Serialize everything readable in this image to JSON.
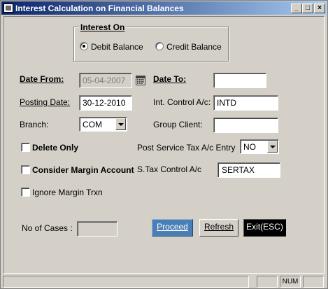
{
  "window": {
    "title": "Interest Calculation on Financial Balances",
    "minimize_glyph": "_",
    "maximize_glyph": "□",
    "close_glyph": "×"
  },
  "interest_on": {
    "label": "Interest On",
    "options": [
      "Debit Balance",
      "Credit Balance"
    ],
    "selected": "Debit Balance"
  },
  "form": {
    "date_from_label": "Date From:",
    "date_from_value": "05-04-2007",
    "date_to_label": "Date To:",
    "date_to_value": "",
    "posting_date_label": "Posting Date:",
    "posting_date_value": "30-12-2010",
    "int_control_label": "Int. Control A/c:",
    "int_control_value": "INTD",
    "branch_label": "Branch:",
    "branch_value": "COM",
    "group_client_label": "Group Client:",
    "group_client_value": "",
    "delete_only_label": "Delete Only",
    "post_service_tax_label": "Post Service Tax A/c Entry",
    "post_service_tax_value": "NO",
    "consider_margin_label": "Consider Margin Account",
    "stax_control_label": "S.Tax Control A/c",
    "stax_control_value": "SERTAX",
    "ignore_margin_label": "Ignore Margin Trxn",
    "no_of_cases_label": "No of Cases :",
    "no_of_cases_value": ""
  },
  "buttons": {
    "proceed": "Proceed",
    "refresh": "Refresh",
    "exit": "Exit(ESC)"
  },
  "statusbar": {
    "num": "NUM"
  },
  "colors": {
    "title_gradient_start": "#0a246a",
    "title_gradient_end": "#a6caf0",
    "proceed_bg": "#4a7fb5",
    "exit_bg": "#000000"
  }
}
